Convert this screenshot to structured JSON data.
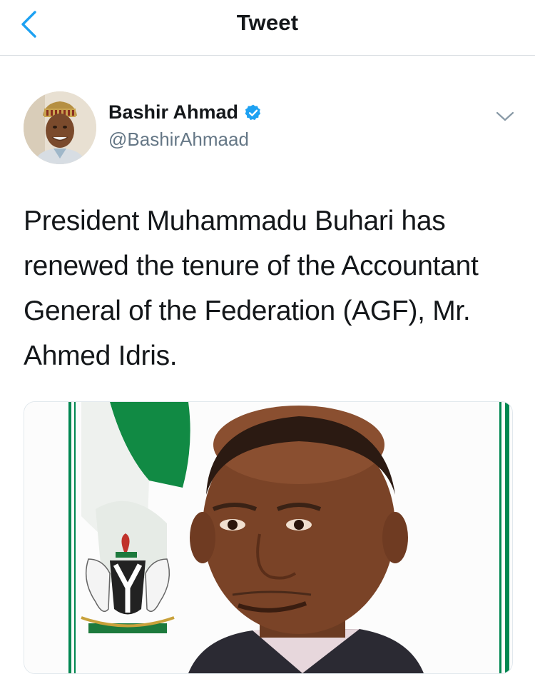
{
  "header": {
    "title": "Tweet",
    "back_icon": "chevron-left-icon",
    "accent": "#1da1f2"
  },
  "author": {
    "name": "Bashir Ahmad",
    "handle": "@BashirAhmaad",
    "verified": true
  },
  "tweet": {
    "text": "President Muhammadu Buhari has renewed the tenure of the Accountant General of the Federation (AGF), Mr. Ahmed Idris."
  },
  "media": {
    "kind": "photo"
  },
  "colors": {
    "text": "#14171a",
    "secondary": "#657786",
    "border": "#e1e8ed",
    "nigeria_green": "#008751"
  }
}
